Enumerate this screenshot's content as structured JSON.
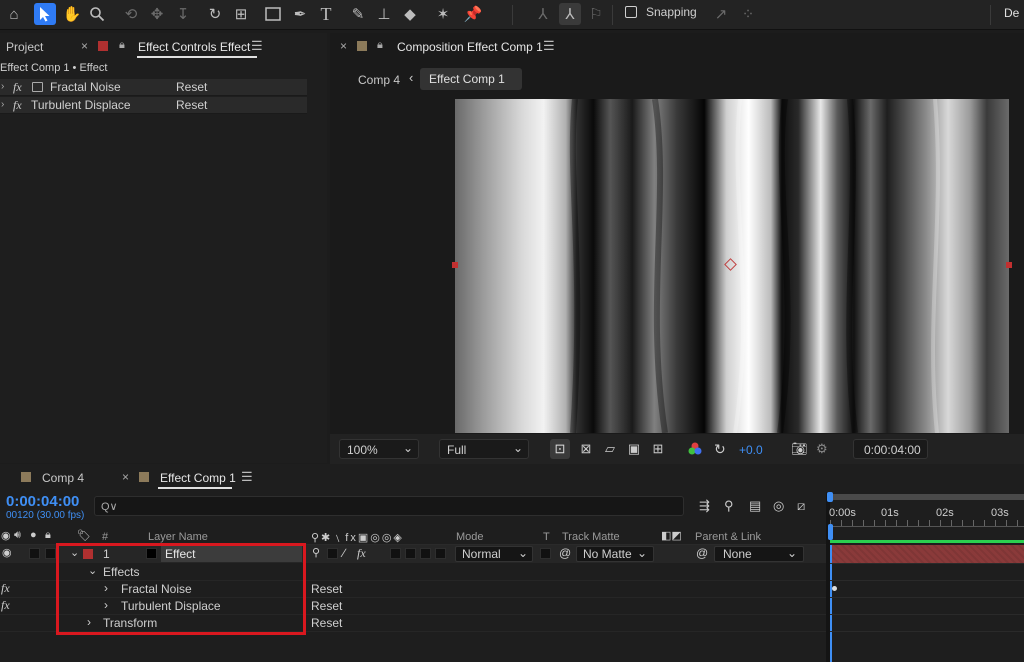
{
  "toolbar": {
    "snapping_label": "Snapping",
    "workspace_label": "De",
    "icons": [
      "home-icon",
      "selection-arrow-icon",
      "hand-icon",
      "zoom-icon",
      "orbit-icon",
      "pan-icon",
      "dolly-icon",
      "rotate-icon",
      "anchor-icon",
      "rectangle-icon",
      "pen-icon",
      "type-icon",
      "brush-icon",
      "clone-stamp-icon",
      "eraser-icon",
      "roto-brush-icon",
      "puppet-pin-icon"
    ]
  },
  "project_panel": {
    "project_tab": "Project",
    "effect_controls_tab": "Effect Controls Effect",
    "breadcrumb": "Effect Comp 1 • Effect",
    "effects": [
      {
        "name": "Fractal Noise",
        "reset": "Reset"
      },
      {
        "name": "Turbulent Displace",
        "reset": "Reset"
      }
    ]
  },
  "composition_panel": {
    "tab_title": "Composition Effect Comp 1",
    "breadcrumb": [
      "Comp 4",
      "Effect Comp 1"
    ],
    "zoom": "100%",
    "resolution": "Full",
    "exposure": "+0.0",
    "timecode": "0:00:04:00"
  },
  "timeline": {
    "tabs": [
      {
        "label": "Comp 4"
      },
      {
        "label": "Effect Comp 1"
      }
    ],
    "current_time": "0:00:04:00",
    "frame_info": "00120 (30.00 fps)",
    "search_placeholder": "Q∨",
    "headers": {
      "number": "#",
      "layer_name": "Layer Name",
      "mode": "Mode",
      "t": "T",
      "track_matte": "Track Matte",
      "parent_link": "Parent & Link"
    },
    "layer": {
      "number": "1",
      "name": "Effect",
      "mode": "Normal",
      "track_matte": "No Matte",
      "parent": "None"
    },
    "effects_group": "Effects",
    "effects": [
      {
        "name": "Fractal Noise",
        "reset": "Reset"
      },
      {
        "name": "Turbulent Displace",
        "reset": "Reset"
      }
    ],
    "transform": {
      "name": "Transform",
      "reset": "Reset"
    },
    "ruler": [
      "0:00s",
      "01s",
      "02s",
      "03s"
    ],
    "colors": {
      "accent_blue": "#3f8ff5",
      "layer_bar": "#8a3a3a",
      "highlight_red": "#d9181f",
      "work_area_green": "#2bd04f"
    }
  }
}
